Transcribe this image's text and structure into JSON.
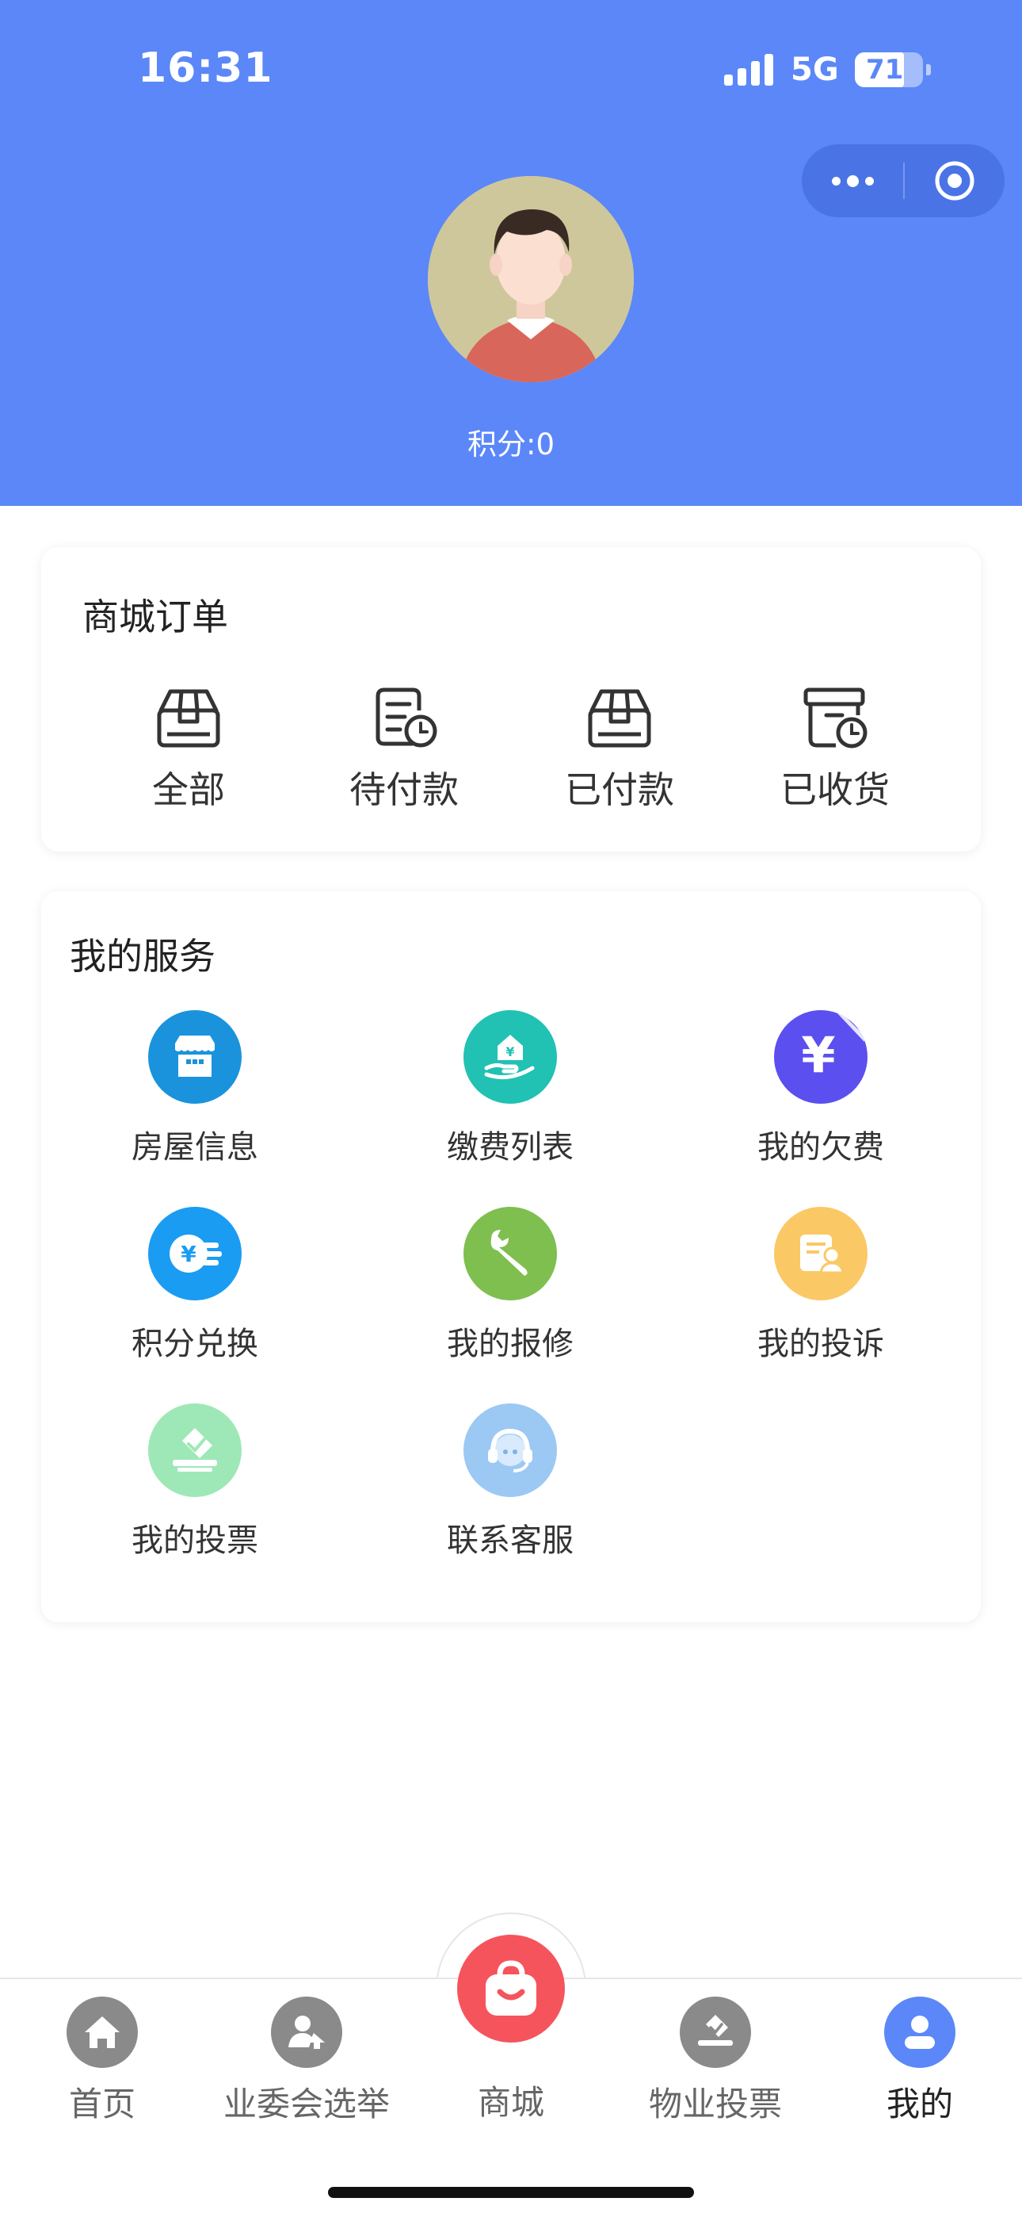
{
  "status_bar": {
    "time": "16:31",
    "network": "5G",
    "battery": "71",
    "battery_level_fraction": 0.71
  },
  "profile": {
    "points_text": "积分:0"
  },
  "orders": {
    "title": "商城订单",
    "items": [
      {
        "label": "全部",
        "icon": "box-icon"
      },
      {
        "label": "待付款",
        "icon": "pending-payment-icon"
      },
      {
        "label": "已付款",
        "icon": "paid-box-icon"
      },
      {
        "label": "已收货",
        "icon": "received-icon"
      }
    ]
  },
  "services": {
    "title": "我的服务",
    "items": [
      {
        "label": "房屋信息",
        "icon": "house-icon",
        "color": "#1a93dc"
      },
      {
        "label": "缴费列表",
        "icon": "payment-hand-icon",
        "color": "#21c1b3"
      },
      {
        "label": "我的欠费",
        "icon": "yen-icon",
        "color": "#5b4ff0"
      },
      {
        "label": "积分兑换",
        "icon": "points-exchange-icon",
        "color": "#1a9cf2"
      },
      {
        "label": "我的报修",
        "icon": "wrench-icon",
        "color": "#7ebf4f"
      },
      {
        "label": "我的投诉",
        "icon": "complaint-icon",
        "color": "#fbc866"
      },
      {
        "label": "我的投票",
        "icon": "vote-icon",
        "color": "#9ee8b7"
      },
      {
        "label": "联系客服",
        "icon": "headset-icon",
        "color": "#9cc8f4"
      }
    ]
  },
  "tabbar": {
    "tabs": [
      {
        "label": "首页",
        "icon": "home-icon"
      },
      {
        "label": "业委会选举",
        "icon": "election-icon"
      },
      {
        "label": "商城",
        "icon": "shopping-bag-icon"
      },
      {
        "label": "物业投票",
        "icon": "ballot-icon"
      },
      {
        "label": "我的",
        "icon": "user-icon"
      }
    ],
    "active": "我的"
  },
  "colors": {
    "accent": "#5b87f8",
    "mall": "#f5545c",
    "inactive_icon": "#8a8a8a"
  }
}
